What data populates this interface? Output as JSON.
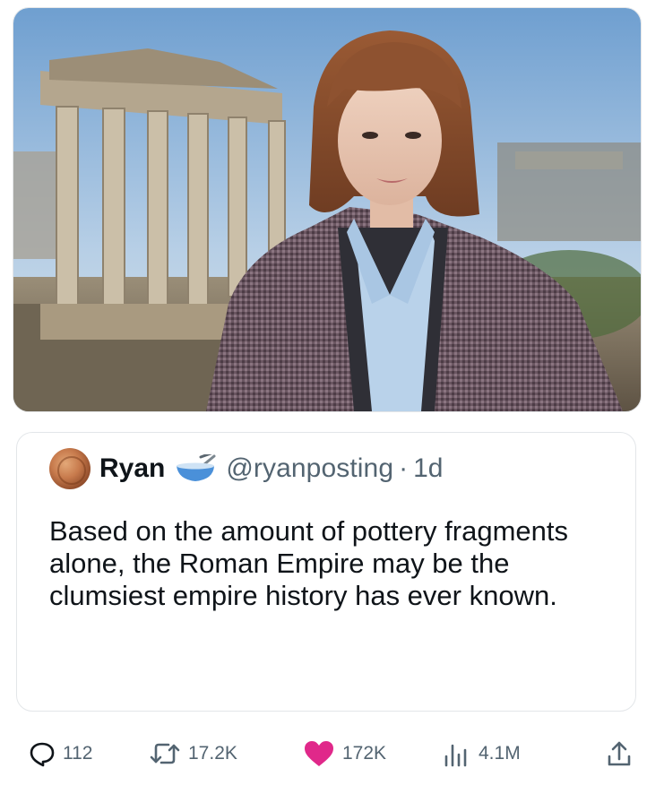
{
  "tweet": {
    "display_name": "Ryan",
    "name_emoji": "bowl-with-spoon-icon",
    "handle": "@ryanposting",
    "separator": "·",
    "time": "1d",
    "text": "Based on the amount of pottery fragments alone, the Roman Empire may be the clumsiest empire history has ever known."
  },
  "actions": {
    "replies": "112",
    "reposts": "17.2K",
    "likes": "172K",
    "views": "4.1M"
  },
  "colors": {
    "secondary_text": "#536471",
    "like_pink": "#f91880",
    "sky": "#8fb8df"
  }
}
